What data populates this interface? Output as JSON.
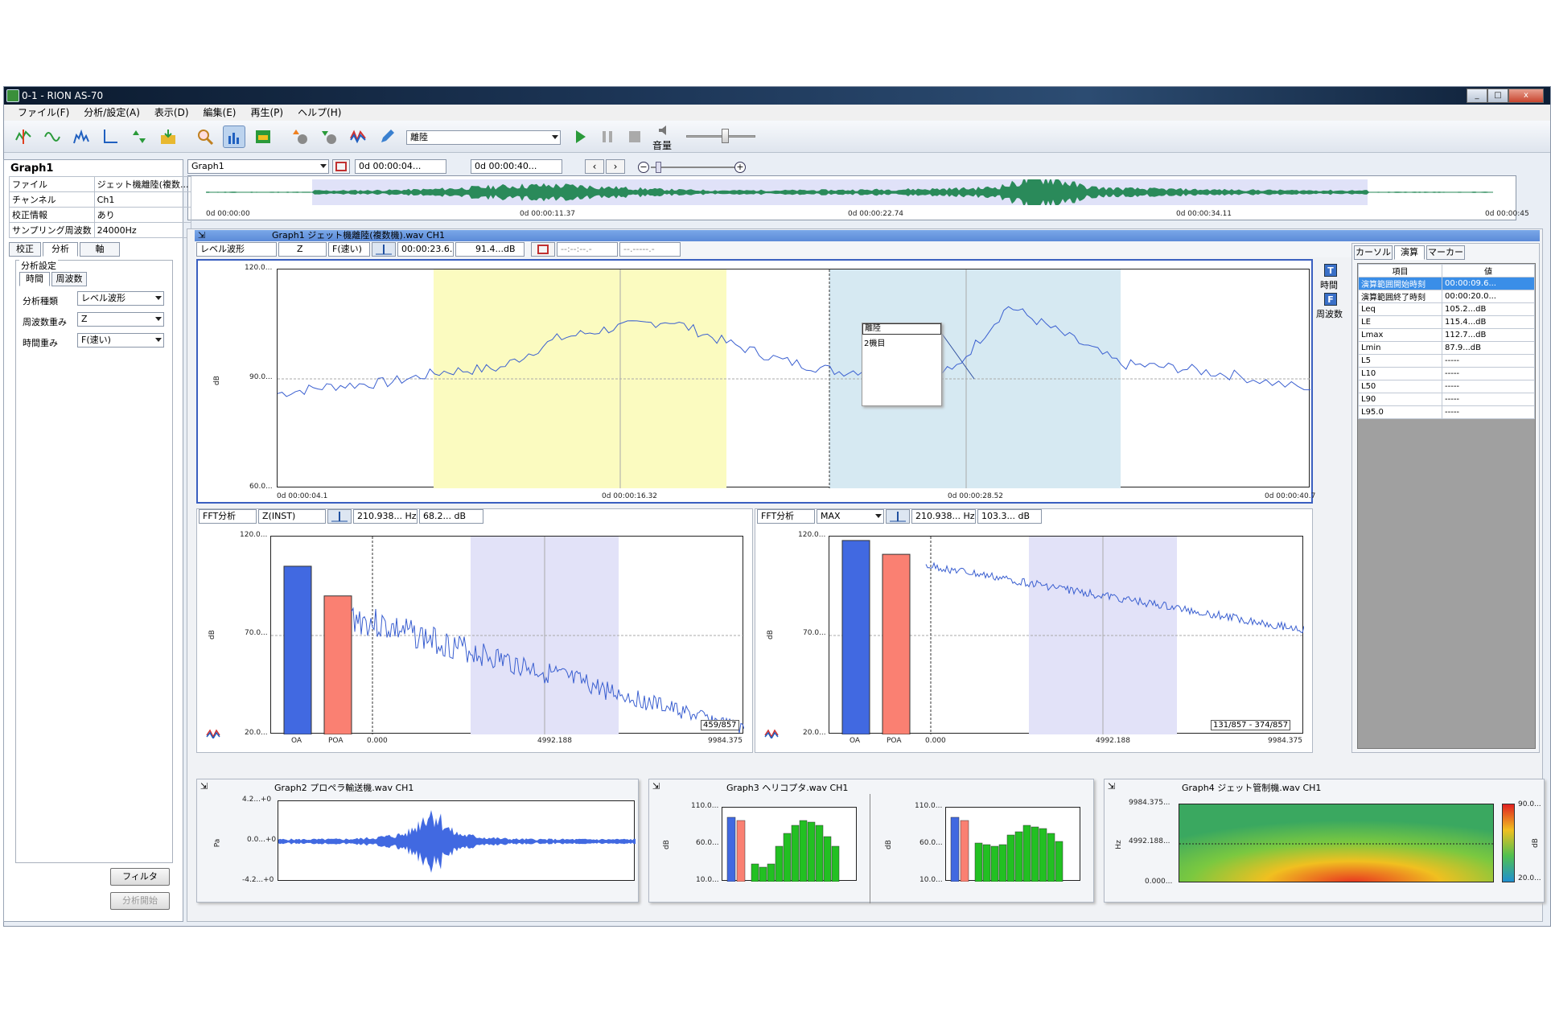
{
  "window": {
    "title": "0-1 - RION AS-70",
    "minimize": "_",
    "maximize": "□",
    "close": "x"
  },
  "menu": [
    "ファイル(F)",
    "分析/設定(A)",
    "表示(D)",
    "編集(E)",
    "再生(P)",
    "ヘルプ(H)"
  ],
  "toolbar": {
    "track_select": "離陸",
    "volume_label": "音量"
  },
  "overview": {
    "graph_select": "Graph1",
    "start": "0d 00:00:04...",
    "end": "0d 00:00:40...",
    "ticks": [
      "0d 00:00:00",
      "0d 00:00:11.37",
      "0d 00:00:22.74",
      "0d 00:00:34.11",
      "0d 00:00:45"
    ]
  },
  "left_panel": {
    "title": "Graph1",
    "props": [
      {
        "k": "ファイル",
        "v": "ジェット機離陸(複数..."
      },
      {
        "k": "チャンネル",
        "v": "Ch1"
      },
      {
        "k": "校正情報",
        "v": "あり"
      },
      {
        "k": "サンプリング周波数",
        "v": "24000Hz"
      }
    ],
    "tabs": [
      "校正",
      "分析",
      "軸"
    ],
    "section": "分析設定",
    "subtabs": [
      "時間",
      "周波数"
    ],
    "settings": [
      {
        "k": "分析種類",
        "v": "レベル波形"
      },
      {
        "k": "周波数重み",
        "v": "Z"
      },
      {
        "k": "時間重み",
        "v": "F(速い)"
      }
    ],
    "filter_btn": "フィルタ",
    "start_btn": "分析開始"
  },
  "graph1": {
    "title": "Graph1  ジェット機離陸(複数機).wav  CH1",
    "ctrl": [
      "レベル波形",
      "Z",
      "F(速い)",
      "00:00:23.6...",
      "91.4...dB",
      "--:--:--.-",
      "--.-----.-"
    ],
    "side_buttons": [
      "時間",
      "周波数"
    ],
    "y_ticks": [
      "120.0...",
      "90.0...",
      "60.0..."
    ],
    "y_unit": "dB",
    "x_ticks": [
      "0d 00:00:04.1",
      "0d 00:00:16.32",
      "0d 00:00:28.52",
      "0d 00:00:40.7"
    ],
    "popup": {
      "title": "離陸",
      "item": "2機目"
    },
    "chart_data": {
      "type": "line",
      "x": [
        4.1,
        6,
        8,
        10,
        12,
        14,
        16,
        18,
        20,
        22,
        24,
        26,
        28,
        30,
        32,
        34,
        36,
        38,
        40.7
      ],
      "values": [
        86,
        88,
        89,
        92,
        93,
        101,
        104,
        106,
        100,
        95,
        92,
        93,
        92,
        110,
        102,
        94,
        93,
        91,
        87
      ],
      "ylim": [
        60,
        120
      ],
      "xlim": [
        4.1,
        40.7
      ]
    }
  },
  "results": {
    "tabs": [
      "カーソル",
      "演算",
      "マーカー"
    ],
    "headers": [
      "項目",
      "値"
    ],
    "rows": [
      [
        "演算範囲開始時刻",
        "00:00:09.6..."
      ],
      [
        "演算範囲終了時刻",
        "00:00:20.0..."
      ],
      [
        "Leq",
        "105.2...dB"
      ],
      [
        "LE",
        "115.4...dB"
      ],
      [
        "Lmax",
        "112.7...dB"
      ],
      [
        "Lmin",
        "87.9...dB"
      ],
      [
        "L5",
        "-----"
      ],
      [
        "L10",
        "-----"
      ],
      [
        "L50",
        "-----"
      ],
      [
        "L90",
        "-----"
      ],
      [
        "L95.0",
        "-----"
      ]
    ]
  },
  "fft1": {
    "ctrl": [
      "FFT分析",
      "Z(INST)",
      "210.938... Hz",
      "68.2... dB"
    ],
    "y_ticks": [
      "120.0...",
      "70.0...",
      "20.0..."
    ],
    "y_unit": "dB",
    "bar_labels": [
      "OA",
      "POA"
    ],
    "x_ticks": [
      "0.000",
      "4992.188",
      "9984.375"
    ],
    "counter": "459/857",
    "chart_data": {
      "type": "bar",
      "categories": [
        "OA",
        "POA"
      ],
      "values": [
        105,
        90
      ],
      "ylim": [
        20,
        120
      ]
    }
  },
  "fft2": {
    "ctrl": [
      "FFT分析",
      "MAX",
      "210.938... Hz",
      "103.3... dB"
    ],
    "y_ticks": [
      "120.0...",
      "70.0...",
      "20.0..."
    ],
    "y_unit": "dB",
    "bar_labels": [
      "OA",
      "POA"
    ],
    "x_ticks": [
      "0.000",
      "4992.188",
      "9984.375"
    ],
    "counter": "131/857 - 374/857",
    "chart_data": {
      "type": "bar",
      "categories": [
        "OA",
        "POA"
      ],
      "values": [
        118,
        111
      ],
      "ylim": [
        20,
        120
      ]
    }
  },
  "graph2": {
    "title": "Graph2  プロペラ輸送機.wav  CH1",
    "y_ticks": [
      "4.2...+0",
      "0.0...+0",
      "-4.2...+0"
    ],
    "y_unit": "Pa"
  },
  "graph3": {
    "title": "Graph3  ヘリコプタ.wav  CH1",
    "y_ticks": [
      "110.0...",
      "60.0...",
      "10.0..."
    ],
    "y_unit": "dB"
  },
  "graph4": {
    "title": "Graph4  ジェット管制機.wav  CH1",
    "y_ticks": [
      "9984.375...",
      "4992.188...",
      "0.000..."
    ],
    "y_unit": "Hz",
    "scale": [
      "90.0...",
      "20.0..."
    ],
    "scale_unit": "dB"
  },
  "colors": {
    "blue_bar": "#4169e1",
    "red_bar": "#fa8072",
    "green_bar": "#22c022",
    "highlight_yellow": "#fbfbc0",
    "highlight_blue": "#d6e9f2",
    "line": "#3a5fd0"
  }
}
